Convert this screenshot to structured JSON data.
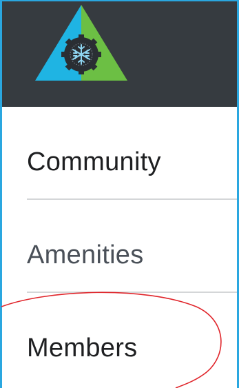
{
  "header": {
    "logo_icon": "snowflake-triangle-logo",
    "colors": {
      "header_bg": "#363b40",
      "logo_left": "#1fb4e3",
      "logo_right": "#6cbf44",
      "logo_gear": "#2a2e33"
    }
  },
  "nav": {
    "items": [
      {
        "label": "Community",
        "state": "active"
      },
      {
        "label": "Amenities",
        "state": "default"
      },
      {
        "label": "Members",
        "state": "default"
      }
    ]
  },
  "annotation": {
    "shape": "ellipse",
    "color": "#e0252b",
    "target": "Members"
  }
}
